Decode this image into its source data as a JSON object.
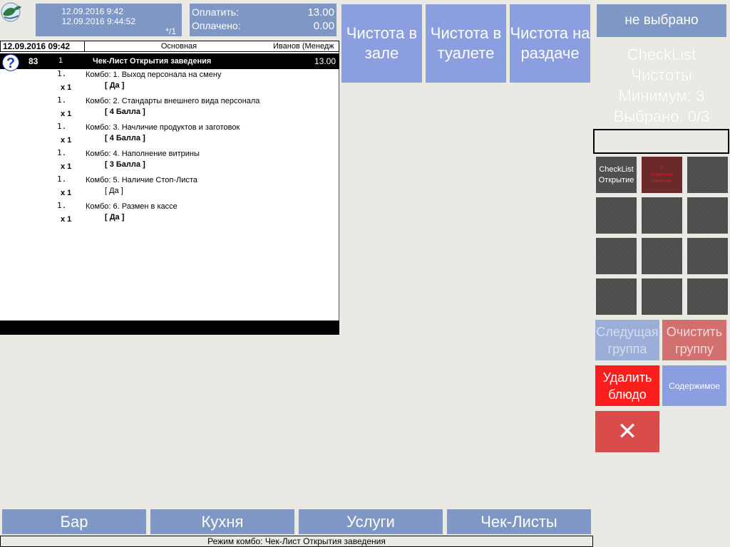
{
  "header": {
    "time_start": "12.09.2016 9:42",
    "time_current": "12.09.2016 9:44:52",
    "guests": "*/1",
    "to_pay_label": "Оплатить:",
    "to_pay_value": "13.00",
    "paid_label": "Оплачено:",
    "paid_value": "0.00"
  },
  "order": {
    "date": "12.09.2016 09:42",
    "type": "Основная",
    "waiter": "Иванов (Менедж",
    "title": {
      "icon": "question-icon",
      "icon_glyph": "?",
      "number": "83",
      "qty": "1",
      "name": "Чек-Лист Открытия заведения",
      "price": "13.00"
    },
    "items": [
      {
        "n": "1.",
        "name": "Комбо: 1. Выход персонала на смену",
        "x": "x 1",
        "value": "[ Да ]"
      },
      {
        "n": "1.",
        "name": "Комбо: 2. Стандарты внешнего вида персонала",
        "x": "x 1",
        "value": "[ 4 Балла ]"
      },
      {
        "n": "1.",
        "name": "Комбо: 3. Начличие продуктов и заготовок",
        "x": "x 1",
        "value": "[ 4 Балла ]"
      },
      {
        "n": "1.",
        "name": "Комбо: 4. Наполнение витрины",
        "x": "x 1",
        "value": "[ 3 Балла ]"
      },
      {
        "n": "1.",
        "name": "Комбо: 5. Наличие Стоп-Листа",
        "x": "x 1",
        "value": "[ Да ]"
      },
      {
        "n": "1.",
        "name": "Комбо: 6. Размен в кассе",
        "x": "x 1",
        "value": "[ Да ]"
      }
    ]
  },
  "categories": [
    "Чистота в зале",
    "Чистота в туалете",
    "Чистота на раздаче"
  ],
  "right": {
    "not_selected": "не выбрано",
    "checklist_line1": "CheckList",
    "checklist_line2": "Чистоты",
    "minimum": "Минимум: 3",
    "selected": "Выбрано: 0/3",
    "grid_btn1_line1": "CheckList",
    "grid_btn1_line2": "Открытие",
    "grid_btn2_line1": "Р",
    "grid_btn2_line2": "ставлено",
    "grid_btn2_line3": "наличие",
    "next_group": "Следущая группа",
    "clear_group": "Очистить группу",
    "delete_dish": "Удалить блюдо",
    "content": "Содержимое",
    "close_icon": "close-icon",
    "close_glyph": "✕"
  },
  "tabs": [
    "Бар",
    "Кухня",
    "Услуги",
    "Чек-Листы"
  ],
  "status": "Режим комбо: Чек-Лист Открытия заведения",
  "colors": {
    "background": "#eae9e4",
    "panel_blue": "#7e97c4",
    "button_blue": "#8a9ee0",
    "delete_red": "#ff1e1e",
    "grid_dark": "#4a4a4a"
  }
}
